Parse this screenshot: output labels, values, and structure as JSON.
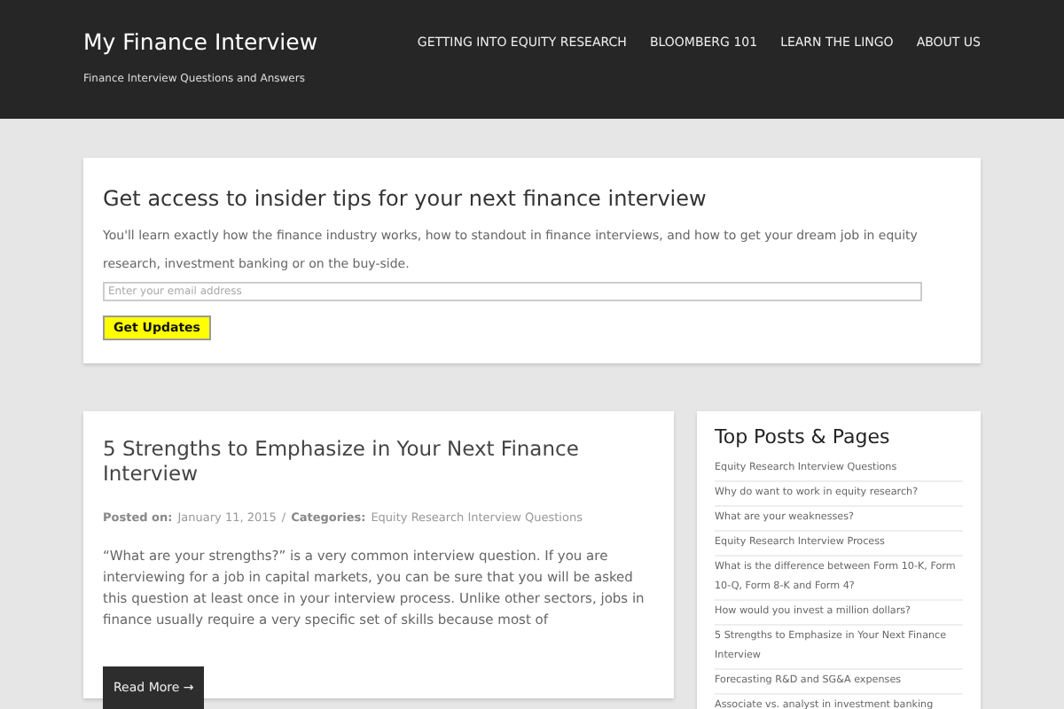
{
  "site": {
    "title": "My Finance Interview",
    "tagline": "Finance Interview Questions and Answers"
  },
  "nav": [
    "GETTING INTO EQUITY RESEARCH",
    "BLOOMBERG 101",
    "LEARN THE LINGO",
    "ABOUT US"
  ],
  "optin": {
    "heading": "Get access to insider tips for your next finance interview",
    "text": "You'll learn exactly how the finance industry works, how to standout in finance interviews, and how to get your dream job in equity research, investment banking or on the buy-side.",
    "placeholder": "Enter your email address",
    "button": "Get Updates"
  },
  "post": {
    "title": "5 Strengths to Emphasize in Your Next Finance Interview",
    "posted_label": "Posted on:",
    "date": "January 11, 2015",
    "separator": "/",
    "categories_label": "Categories:",
    "category": "Equity Research Interview Questions",
    "excerpt": "“What are your strengths?” is a very common interview question. If you are interviewing for a job in capital markets, you can be sure that you will be asked this question at least once in your interview process. Unlike other sectors, jobs in finance usually require a very specific set of skills because most of",
    "button": "Read More →"
  },
  "sidebar": {
    "heading": "Top Posts & Pages",
    "items": [
      "Equity Research Interview Questions",
      "Why do want to work in equity research?",
      "What are your weaknesses?",
      "Equity Research Interview Process",
      "What is the difference between Form 10-K, Form 10-Q, Form 8-K and Form 4?",
      "How would you invest a million dollars?",
      "5 Strengths to Emphasize in Your Next Finance Interview",
      "Forecasting R&D and SG&A expenses",
      "Associate vs. analyst in investment banking"
    ]
  }
}
